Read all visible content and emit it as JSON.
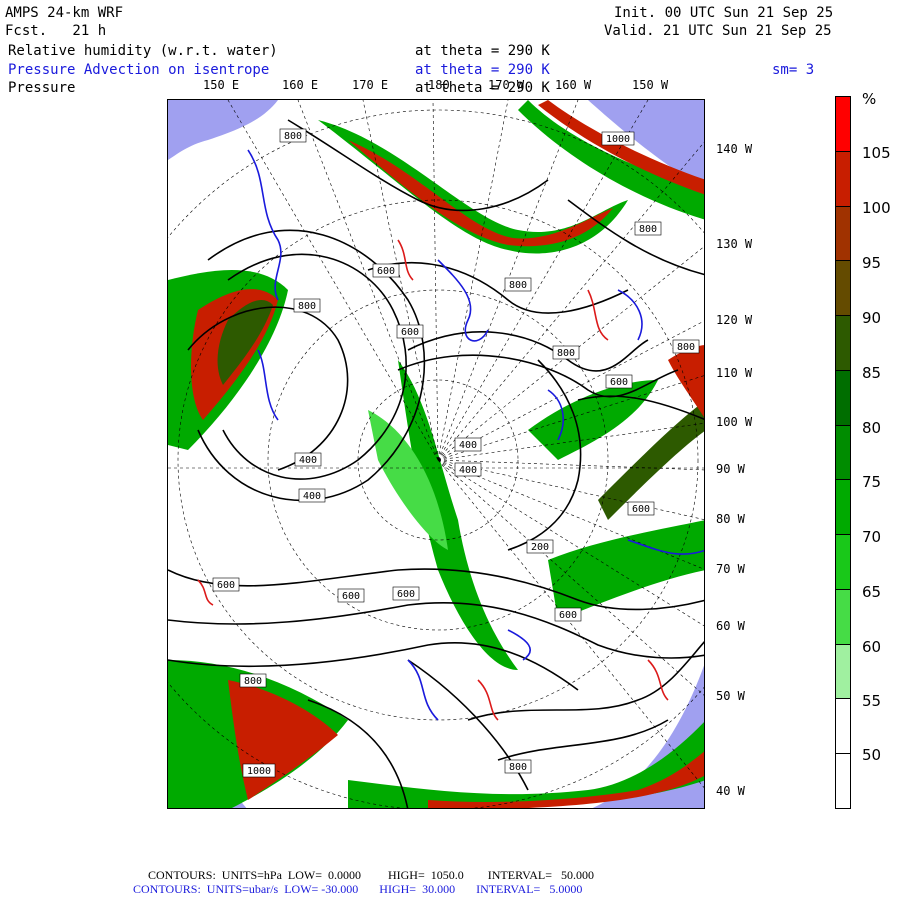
{
  "header": {
    "model": "AMPS 24-km WRF",
    "fcst": "Fcst.   21 h",
    "init": "Init. 00 UTC Sun 21 Sep 25",
    "valid": "Valid. 21 UTC Sun 21 Sep 25",
    "fields": [
      {
        "label": "Relative humidity (w.r.t. water)",
        "level": "at theta = 290 K",
        "color": "#000000"
      },
      {
        "label": "Pressure Advection on isentrope",
        "level": "at theta = 290 K",
        "color": "#1a1adc"
      },
      {
        "label": "Pressure",
        "level": "at theta = 290 K",
        "color": "#000000"
      }
    ],
    "smoothing": "sm= 3"
  },
  "map": {
    "lon_labels_top": [
      "150 E",
      "160 E",
      "170 E",
      "180",
      "170 W",
      "160 W",
      "150 W"
    ],
    "lon_labels_right": [
      "140 W",
      "130 W",
      "120 W",
      "110 W",
      "100 W",
      "90 W",
      "80 W",
      "70 W",
      "60 W",
      "50 W",
      "40 W"
    ],
    "pressure_labels": [
      "800",
      "1000",
      "800",
      "600",
      "800",
      "800",
      "600",
      "800",
      "600",
      "800",
      "400",
      "400",
      "400",
      "400",
      "600",
      "600",
      "600",
      "600",
      "200",
      "600",
      "800",
      "1000",
      "800"
    ],
    "land_color": "#a0a0f0",
    "rh_contour_color": "#000000",
    "advection_pos_color": "#dc1a1a",
    "advection_neg_color": "#1a1adc"
  },
  "colorbar": {
    "unit": "%",
    "labels": [
      "105",
      "100",
      "95",
      "90",
      "85",
      "80",
      "75",
      "70",
      "65",
      "60",
      "55",
      "50"
    ],
    "colors": [
      "#ff0000",
      "#c81e00",
      "#a03200",
      "#644b00",
      "#2d5a00",
      "#006e00",
      "#008c00",
      "#00aa00",
      "#19c819",
      "#46dc46",
      "#a0f0a0",
      "#ffffff",
      "#ffffff"
    ]
  },
  "footer": {
    "line1": "CONTOURS:  UNITS=hPa  LOW=  0.0000         HIGH=  1050.0        INTERVAL=   50.000",
    "line2": "CONTOURS:  UNITS=ubar/s  LOW= -30.000       HIGH=  30.000       INTERVAL=   5.0000"
  }
}
